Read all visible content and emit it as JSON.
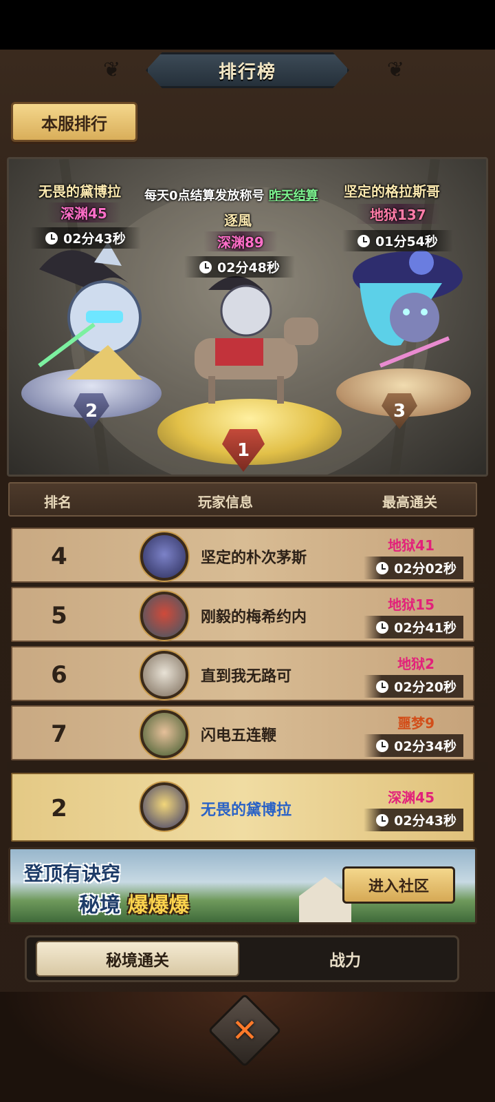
{
  "header": {
    "title": "排行榜"
  },
  "tabs_top": {
    "server_rank": "本服排行"
  },
  "podium": {
    "notice_prefix": "每天0点结算发放称号",
    "notice_link": "昨天结算",
    "first": {
      "name": "逐風",
      "level": "深渊89",
      "time": "02分48秒",
      "rank": "1"
    },
    "second": {
      "name": "无畏的黛博拉",
      "level": "深渊45",
      "time": "02分43秒",
      "rank": "2"
    },
    "third": {
      "name": "坚定的格拉斯哥",
      "level": "地狱137",
      "time": "01分54秒",
      "rank": "3"
    }
  },
  "table": {
    "headers": {
      "rank": "排名",
      "player": "玩家信息",
      "best": "最高通关"
    },
    "rows": [
      {
        "rank": "4",
        "name": "坚定的朴次茅斯",
        "level": "地狱41",
        "time": "02分02秒"
      },
      {
        "rank": "5",
        "name": "刚毅的梅希约内",
        "level": "地狱15",
        "time": "02分41秒"
      },
      {
        "rank": "6",
        "name": "直到我无路可",
        "level": "地狱2",
        "time": "02分20秒"
      },
      {
        "rank": "7",
        "name": "闪电五连鞭",
        "level": "噩梦9",
        "time": "02分34秒"
      }
    ],
    "self": {
      "rank": "2",
      "name": "无畏的黛博拉",
      "level": "深渊45",
      "time": "02分43秒"
    }
  },
  "banner": {
    "line1": "登顶有诀窍",
    "line2_a": "秘境",
    "line2_b": "爆爆爆",
    "button": "进入社区"
  },
  "bottom_tabs": {
    "active": "秘境通关",
    "inactive": "战力"
  },
  "colors": {
    "abyss": "#ff6fc9",
    "hell": "#e2217a",
    "nightmare": "#d24e1a",
    "self_name": "#2a62c6"
  }
}
